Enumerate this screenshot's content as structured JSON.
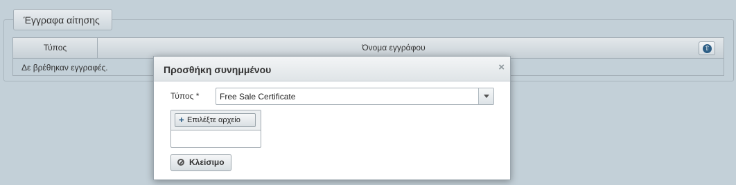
{
  "panel": {
    "legend": "Έγγραφα αίτησης",
    "table": {
      "columns": [
        "Τύπος",
        "Όνομα εγγράφου"
      ],
      "empty_message": "Δε βρέθηκαν εγγραφές.",
      "upload_icon": "arrow-up-circle-icon"
    }
  },
  "modal": {
    "title": "Προσθήκη συνημμένου",
    "close_icon": "close-icon",
    "type_label": "Τύπος *",
    "type_value": "Free Sale Certificate",
    "choose_file_label": "Επιλέξτε αρχείο",
    "choose_file_icon": "plus-icon",
    "close_button_label": "Κλείσιμο",
    "close_button_icon": "ban-icon"
  },
  "colors": {
    "background": "#c3d0d8",
    "accent": "#2e5f86"
  }
}
